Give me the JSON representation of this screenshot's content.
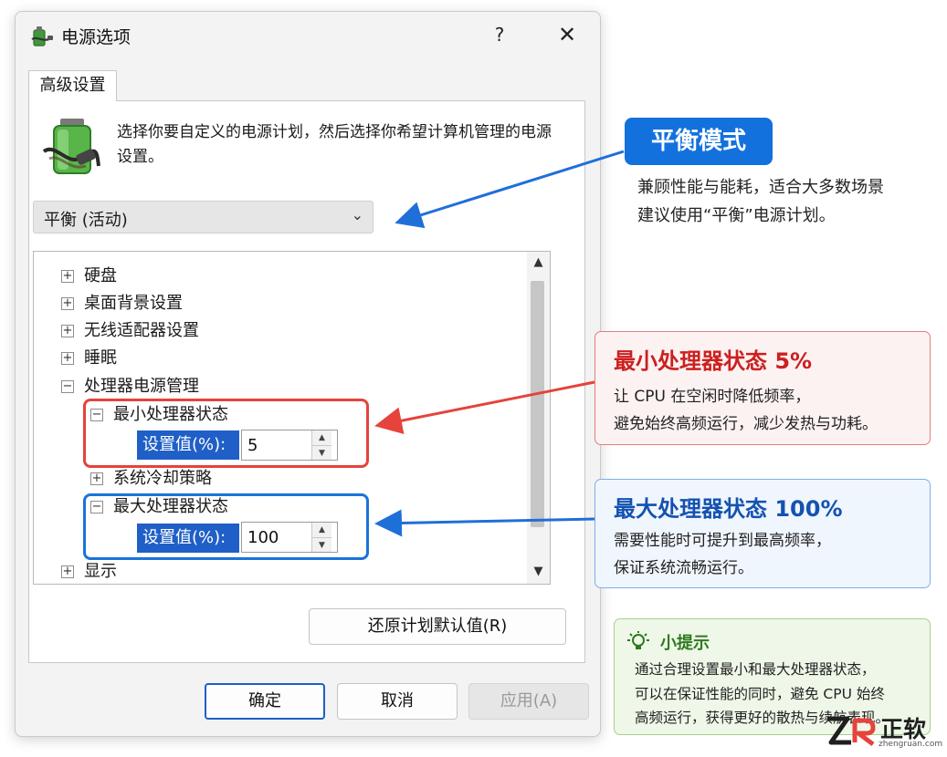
{
  "window": {
    "title": "电源选项",
    "help_label": "?",
    "close_label": "✕",
    "tab_label": "高级设置"
  },
  "description": "选择你要自定义的电源计划，然后选择你希望计算机管理的电源设置。",
  "plan_select": {
    "value": "平衡 (活动)",
    "chevron": "⌄"
  },
  "tree": {
    "items": [
      {
        "label": "硬盘",
        "expander": "+"
      },
      {
        "label": "桌面背景设置",
        "expander": "+"
      },
      {
        "label": "无线适配器设置",
        "expander": "+"
      },
      {
        "label": "睡眠",
        "expander": "+"
      },
      {
        "label": "处理器电源管理",
        "expander": "−"
      },
      {
        "label": "最小处理器状态",
        "expander": "−"
      },
      {
        "label": "系统冷却策略",
        "expander": "+"
      },
      {
        "label": "最大处理器状态",
        "expander": "−"
      },
      {
        "label": "显示",
        "expander": "+"
      }
    ],
    "min_setting": {
      "label": "设置值(%):",
      "value": "5"
    },
    "max_setting": {
      "label": "设置值(%):",
      "value": "100"
    }
  },
  "buttons": {
    "restore": "还原计划默认值(R)",
    "ok": "确定",
    "cancel": "取消",
    "apply": "应用(A)"
  },
  "annotations": {
    "balanced": {
      "badge": "平衡模式",
      "line1": "兼顾性能与能耗，适合大多数场景",
      "line2": "建议使用“平衡”电源计划。"
    },
    "min": {
      "title": "最小处理器状态  5%",
      "line1": "让 CPU 在空闲时降低频率，",
      "line2": "避免始终高频运行，减少发热与功耗。"
    },
    "max": {
      "title": "最大处理器状态  100%",
      "line1": "需要性能时可提升到最高频率，",
      "line2": "保证系统流畅运行。"
    },
    "tip": {
      "title": "小提示",
      "line1": "通过合理设置最小和最大处理器状态，",
      "line2": "可以在保证性能的同时，避免 CPU 始终",
      "line3": "高频运行，获得更好的散热与续航表现。"
    }
  },
  "watermark": {
    "text": "正软",
    "url": "zhengruan.com"
  },
  "colors": {
    "accent_blue": "#1271dd",
    "selection_blue": "#1f5fc7",
    "annotation_red": "#e5433c",
    "tip_green": "#2e7a1f"
  },
  "icons": [
    "power-options-icon",
    "battery-plug-icon",
    "lightbulb-icon",
    "chevron-down-icon",
    "close-icon"
  ]
}
